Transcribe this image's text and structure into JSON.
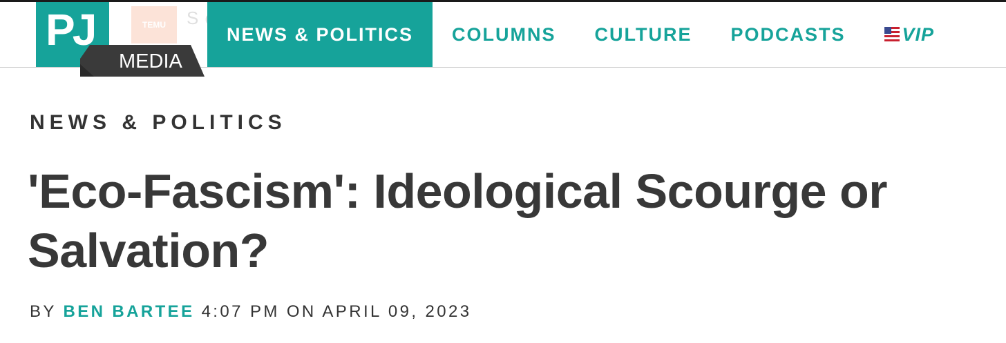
{
  "ad": {
    "logo_text": "TEMU",
    "text": "S         emu"
  },
  "logo": {
    "pj": "PJ",
    "media": "MEDIA"
  },
  "nav": {
    "items": [
      {
        "label": "NEWS & POLITICS",
        "active": true
      },
      {
        "label": "COLUMNS",
        "active": false
      },
      {
        "label": "CULTURE",
        "active": false
      },
      {
        "label": "PODCASTS",
        "active": false
      },
      {
        "label": "VIP",
        "active": false,
        "icon": "us-flag-icon"
      }
    ]
  },
  "article": {
    "category": "NEWS & POLITICS",
    "title": "'Eco-Fascism': Ideological Scourge or Salvation?",
    "byline_prefix": "BY",
    "author": "BEN BARTEE",
    "time": "4:07 PM",
    "date_prefix": "ON",
    "date": "APRIL 09, 2023"
  },
  "colors": {
    "brand_teal": "#16a39a",
    "dark_slate": "#3a3a3a",
    "text": "#333333"
  }
}
